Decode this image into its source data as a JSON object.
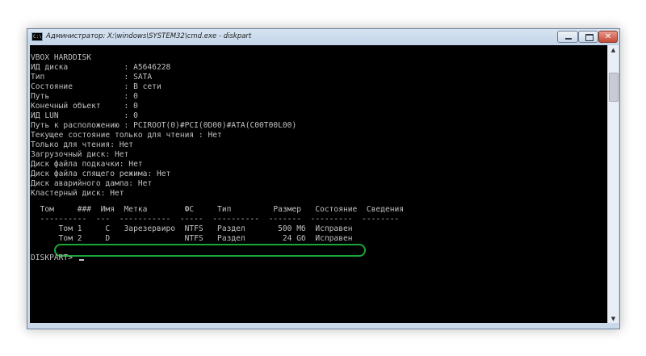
{
  "window": {
    "title": "Администратор: X:\\windows\\SYSTEM32\\cmd.exe - diskpart",
    "icon_label": "C:\\",
    "buttons": {
      "minimize": "minimize-icon",
      "maximize": "maximize-icon",
      "close": "✕"
    }
  },
  "console": {
    "lines": [
      "VBOX HARDDISK",
      "ИД диска            : A5646228",
      "Тип                 : SATA",
      "Состояние           : В сети",
      "Путь                : 0",
      "Конечный объект     : 0",
      "ИД LUN              : 0",
      "Путь к расположению : PCIROOT(0)#PCI(0D00)#ATA(C00T00L00)",
      "Текущее состояние только для чтения : Нет",
      "Только для чтения: Нет",
      "Загрузочный диск: Нет",
      "Диск файла подкачки: Нет",
      "Диск файла спящего режима: Нет",
      "Диск аварийного дампа: Нет",
      "Кластерный диск: Нет",
      "",
      "  Том     ###  Имя  Метка        ФС     Тип         Размер   Состояние  Сведения",
      "  ----------  ---  -----------  -----  ----------  -------  ---------  --------",
      "      Том 1     C   Зарезервиро  NTFS   Раздел       500 Мб  Исправен",
      "      Том 2     D                NTFS   Раздел        24 Gб  Исправен",
      "",
      "DISKPART> "
    ],
    "text_color": "#c0c0c0",
    "background": "#000000",
    "highlight_color": "#1aa538"
  },
  "scrollbar": {
    "up": "▲",
    "down": "▼"
  }
}
